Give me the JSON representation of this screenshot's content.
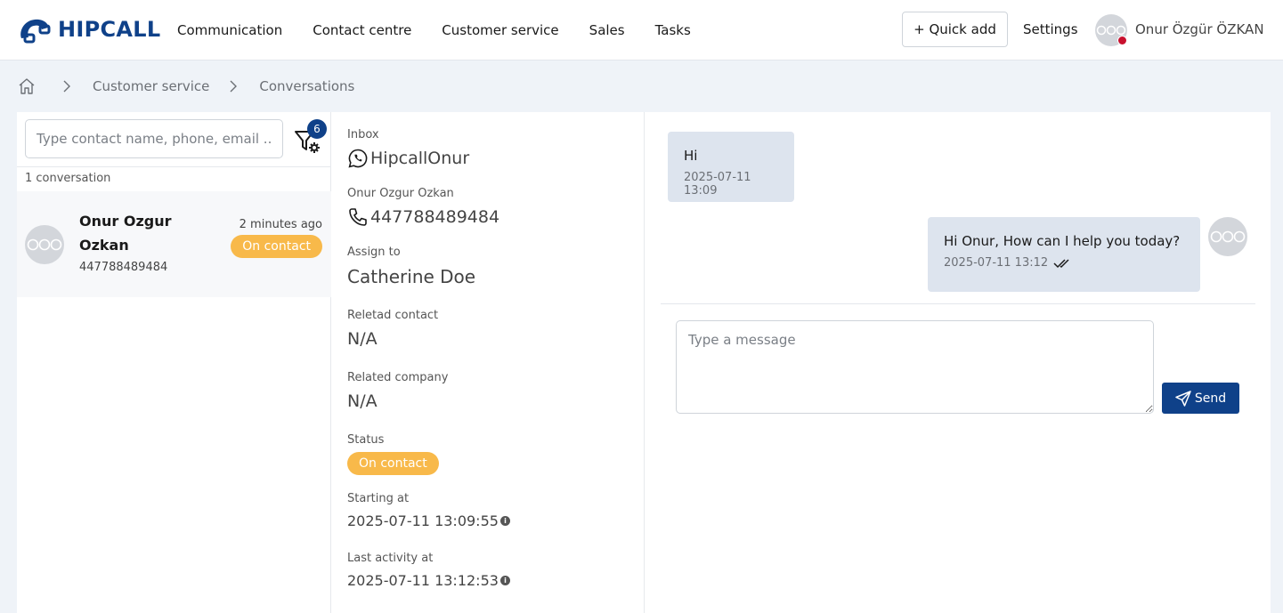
{
  "header": {
    "logo_text": "HIPCALL",
    "nav": [
      "Communication",
      "Contact centre",
      "Customer service",
      "Sales",
      "Tasks"
    ],
    "quick_add": "+ Quick add",
    "settings": "Settings",
    "user_name": "Onur Özgür ÖZKAN"
  },
  "breadcrumb": {
    "items": [
      "Customer service",
      "Conversations"
    ]
  },
  "left": {
    "search_placeholder": "Type contact name, phone, email ...",
    "filter_count": "6",
    "conversation_count": "1 conversation",
    "conversation": {
      "name": "Onur Ozgur Ozkan",
      "phone": "447788489484",
      "time": "2 minutes ago",
      "status": "On contact"
    }
  },
  "details": {
    "inbox_label": "Inbox",
    "inbox_value": "HipcallOnur",
    "contact_label": "Onur Ozgur Ozkan",
    "contact_phone": "447788489484",
    "assign_label": "Assign to",
    "assign_value": "Catherine Doe",
    "related_contact_label": "Reletad contact",
    "related_contact_value": "N/A",
    "related_company_label": "Related company",
    "related_company_value": "N/A",
    "status_label": "Status",
    "status_value": "On contact",
    "starting_label": "Starting at",
    "starting_value": "2025-07-11 13:09:55",
    "last_activity_label": "Last activity at",
    "last_activity_value": "2025-07-11 13:12:53"
  },
  "chat": {
    "messages": [
      {
        "text": "Hi",
        "time": "2025-07-11 13:09",
        "direction": "in"
      },
      {
        "text": "Hi Onur, How can I help you today?",
        "time": "2025-07-11 13:12",
        "direction": "out"
      }
    ],
    "input_placeholder": "Type a message",
    "send_label": "Send"
  },
  "colors": {
    "brand": "#0f4189",
    "badge": "#f8b94a",
    "status_dot": "#c8102e",
    "bubble": "#dde4ee"
  }
}
